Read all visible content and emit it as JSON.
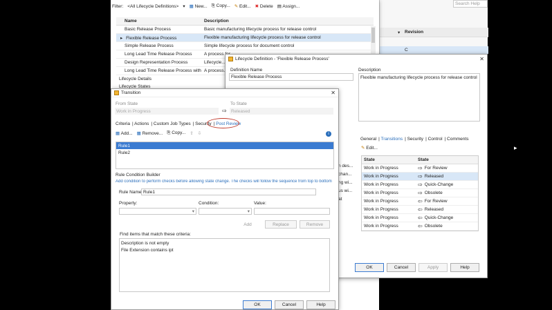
{
  "background": {
    "search_placeholder": "Search Help",
    "revision_header": "Revision",
    "revision_value": "C"
  },
  "main": {
    "filter_label": "Filter:",
    "filter_value": "<All Lifecycle Definitions>",
    "toolbar": {
      "new": "New...",
      "copy": "Copy...",
      "edit": "Edit...",
      "delete": "Delete",
      "assign": "Assign..."
    },
    "columns": [
      "Name",
      "Description"
    ],
    "rows": [
      {
        "name": "Basic Release Process",
        "desc": "Basic manufacturing lifecycle process for release control"
      },
      {
        "name": "Flexible Release Process",
        "desc": "Flexible manufacturing lifecycle process for release control"
      },
      {
        "name": "Simple Release Process",
        "desc": "Simple lifecycle process for document control"
      },
      {
        "name": "Long Lead Time Release Process",
        "desc": "A process for..."
      },
      {
        "name": "Design Representation Process",
        "desc": "Lifecycle..."
      },
      {
        "name": "Long Lead Time Release Process with Change",
        "desc": "A process..."
      }
    ],
    "lifecycle_details": "Lifecycle Details",
    "lifecycle_states": "Lifecycle States"
  },
  "definition": {
    "title": "Lifecycle Definition - 'Flexible Release Process'",
    "name_label": "Definition Name",
    "name_value": "Flexible Release Process",
    "desc_label": "Description",
    "desc_value": "Flexible manufacturing lifecycle process for release control",
    "tabs": [
      "General",
      "Transitions",
      "Security",
      "Control",
      "Comments"
    ],
    "edit": "Edit...",
    "col_from": "State",
    "col_to": "State",
    "transitions": [
      {
        "from": "Work in Progress",
        "dir": "⇨",
        "to": "For Review"
      },
      {
        "from": "Work in Progress",
        "dir": "⇨",
        "to": "Released"
      },
      {
        "from": "Work in Progress",
        "dir": "⇨",
        "to": "Quick-Change"
      },
      {
        "from": "Work in Progress",
        "dir": "⇨",
        "to": "Obsolete"
      },
      {
        "from": "Work in Progress",
        "dir": "⇦",
        "to": "For Review"
      },
      {
        "from": "Work in Progress",
        "dir": "⇦",
        "to": "Released"
      },
      {
        "from": "Work in Progress",
        "dir": "⇦",
        "to": "Quick-Change"
      },
      {
        "from": "Work in Progress",
        "dir": "⇦",
        "to": "Obsolete"
      }
    ],
    "partial_lines": [
      "n des...",
      "chan...",
      "ng wi...",
      "us wi...",
      "at"
    ],
    "buttons": {
      "ok": "OK",
      "cancel": "Cancel",
      "apply": "Apply",
      "help": "Help"
    }
  },
  "transition": {
    "title": "Transition",
    "from_label": "From State",
    "from_value": "Work in Progress",
    "to_label": "To State",
    "to_value": "Released",
    "arrow": "⇨",
    "tabs": [
      "Criteria",
      "Actions",
      "Custom Job Types",
      "Security",
      "Post Review"
    ],
    "toolbar": {
      "add": "Add...",
      "remove": "Remove...",
      "copy": "Copy..."
    },
    "rules": [
      {
        "label": "Rule1"
      },
      {
        "label": "Rule2"
      }
    ],
    "builder_title": "Rule Condition Builder",
    "builder_hint": "Add condition to perform checks before allowing state change. The checks will follow the sequence from top to bottom",
    "rule_name_label": "Rule Name:",
    "rule_name_value": "Rule1",
    "property_label": "Property:",
    "condition_label": "Condition:",
    "value_label": "Value:",
    "btn_add": "Add",
    "btn_replace": "Replace",
    "btn_remove": "Remove",
    "find_label": "Find items that match these criteria:",
    "criteria": [
      "Description is not empty",
      "File Extension contains ipt"
    ],
    "buttons": {
      "ok": "OK",
      "cancel": "Cancel",
      "help": "Help"
    },
    "highlight_color": "#c0392b"
  }
}
